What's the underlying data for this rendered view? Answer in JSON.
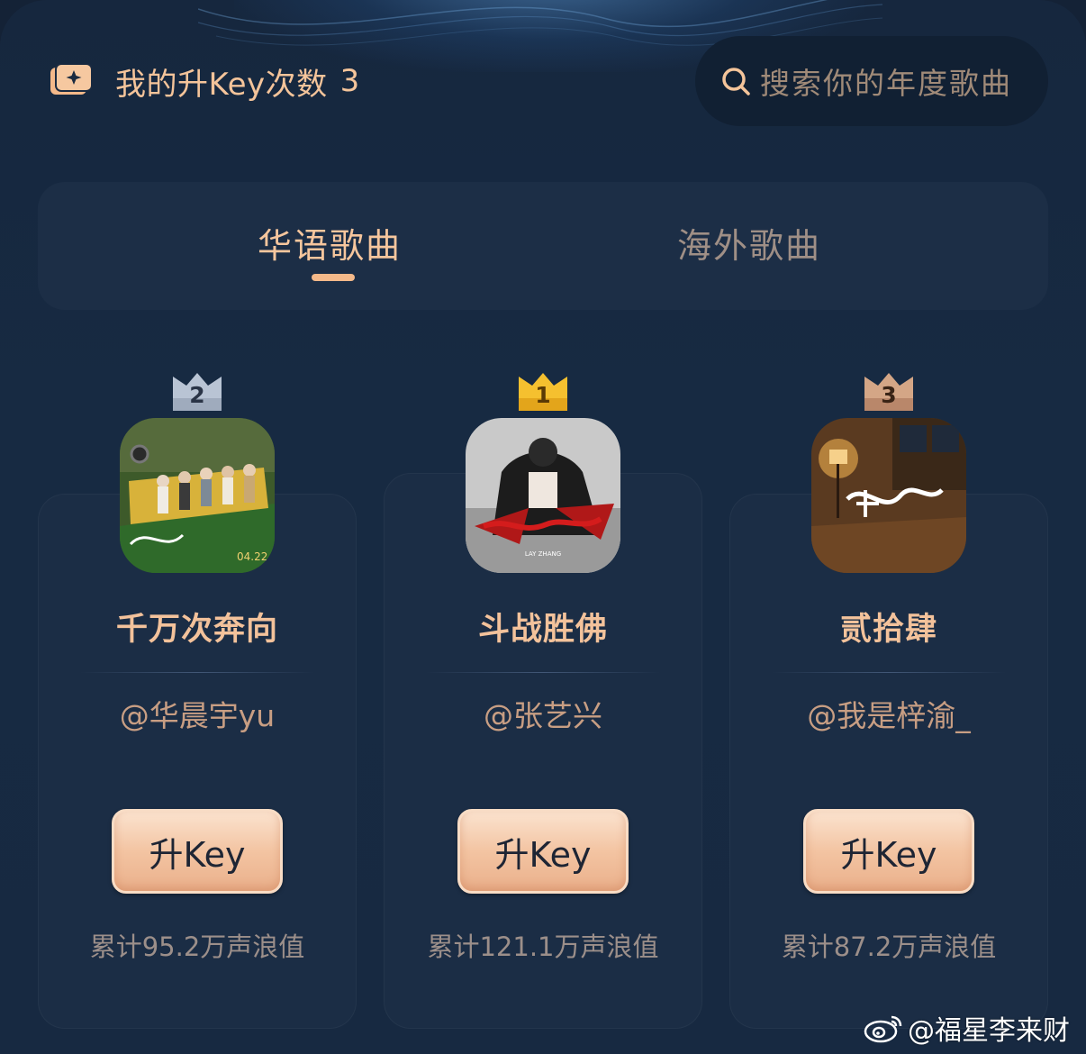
{
  "header": {
    "key_count_label": "我的升Key次数",
    "key_count_value": "3",
    "search_placeholder": "搜索你的年度歌曲"
  },
  "tabs": [
    {
      "label": "华语歌曲",
      "active": true
    },
    {
      "label": "海外歌曲",
      "active": false
    }
  ],
  "ranking": [
    {
      "rank": "2",
      "title": "千万次奔向",
      "artist": "@华晨宇yu",
      "button": "升Key",
      "score": "累计95.2万声浪值",
      "crown_color": "#b8c2d2"
    },
    {
      "rank": "1",
      "title": "斗战胜佛",
      "artist": "@张艺兴",
      "button": "升Key",
      "score": "累计121.1万声浪值",
      "crown_color": "#f2b82c"
    },
    {
      "rank": "3",
      "title": "贰拾肆",
      "artist": "@我是梓渝_",
      "button": "升Key",
      "score": "累计87.2万声浪值",
      "crown_color": "#c99a78"
    }
  ],
  "covers": {
    "c2_date": "04.22",
    "c1_artist": "LAY ZHANG"
  },
  "watermark": "@福星李来财",
  "colors": {
    "accent": "#f4c49a",
    "background": "#172941",
    "button": "#f3c4a2"
  }
}
